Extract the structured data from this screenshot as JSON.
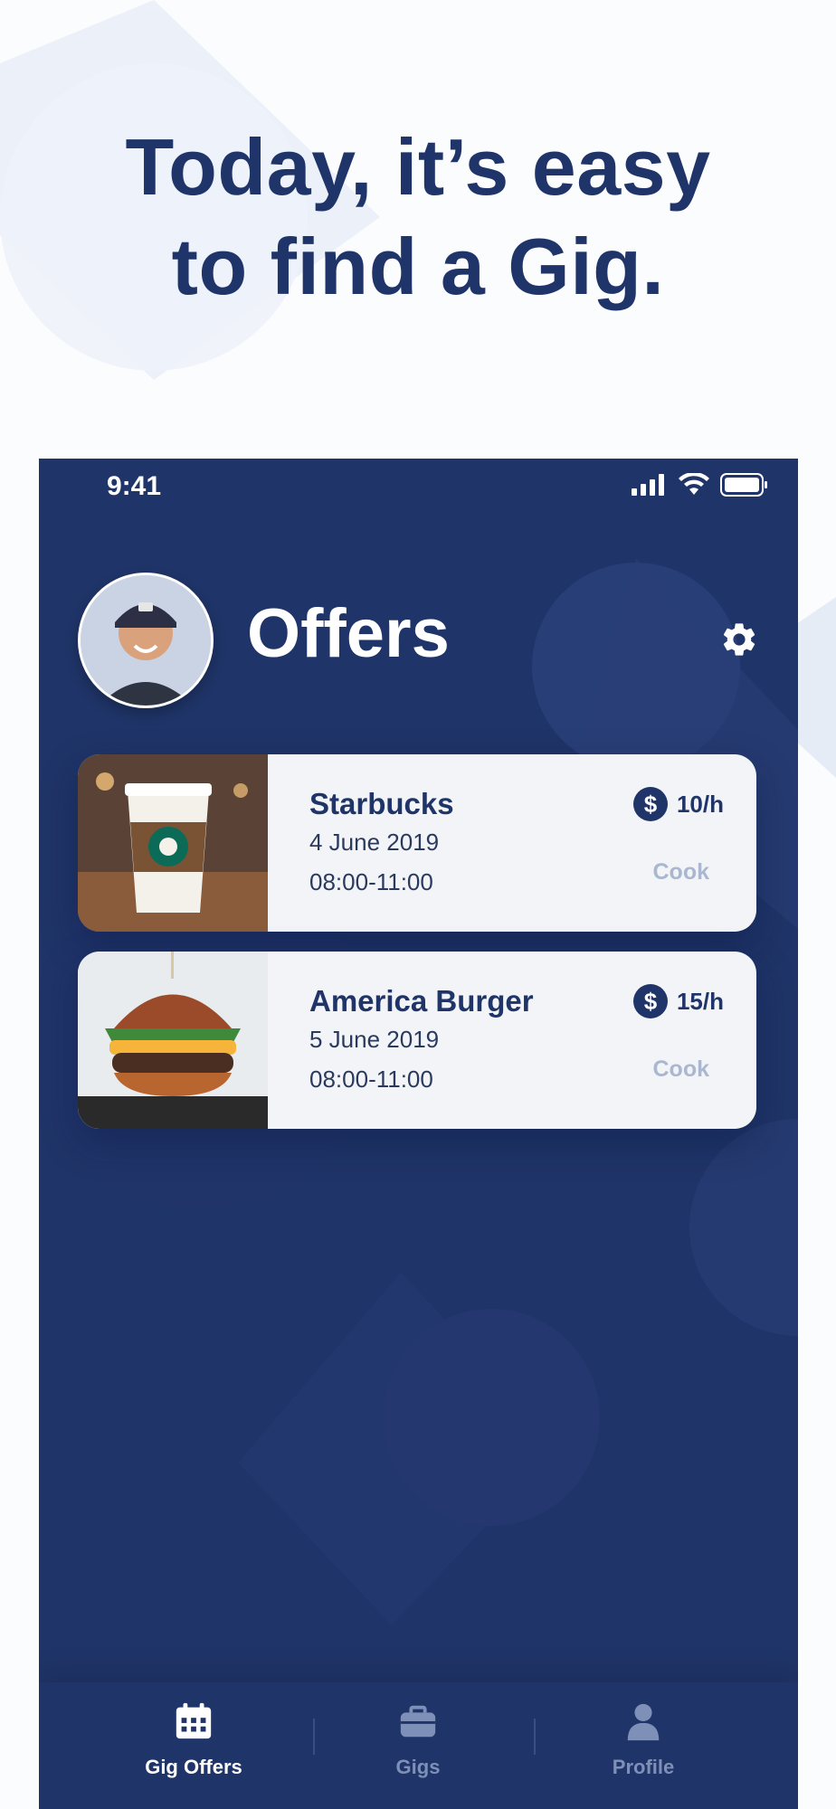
{
  "hero": {
    "line1": "Today, it’s easy",
    "line2": "to find a Gig."
  },
  "status_bar": {
    "time": "9:41",
    "icons": [
      "signal-icon",
      "wifi-icon",
      "battery-icon"
    ]
  },
  "header": {
    "title": "Offers",
    "avatar_icon": "avatar",
    "settings_icon": "gear-icon"
  },
  "offers": [
    {
      "name": "Starbucks",
      "date": "4 June 2019",
      "time": "08:00-11:00",
      "rate": "10/h",
      "role": "Cook",
      "image": "coffee-cup-photo"
    },
    {
      "name": "America Burger",
      "date": "5 June 2019",
      "time": "08:00-11:00",
      "rate": "15/h",
      "role": "Cook",
      "image": "burger-photo"
    }
  ],
  "tabs": [
    {
      "label": "Gig Offers",
      "icon": "calendar-icon",
      "active": true
    },
    {
      "label": "Gigs",
      "icon": "briefcase-icon",
      "active": false
    },
    {
      "label": "Profile",
      "icon": "person-icon",
      "active": false
    }
  ],
  "colors": {
    "primary": "#1f3468",
    "card_bg": "#f3f4f7",
    "muted": "#a9b7d0",
    "tab_inactive": "#7f90b8"
  }
}
